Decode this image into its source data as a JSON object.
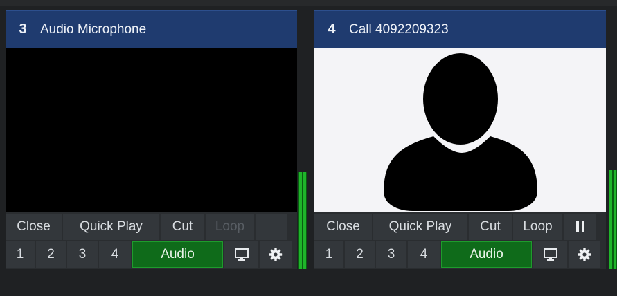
{
  "inputs": [
    {
      "number": "3",
      "title": "Audio Microphone",
      "row1": [
        "Close",
        "Quick Play",
        "Cut",
        "Loop",
        ""
      ],
      "row2": [
        "1",
        "2",
        "3",
        "4",
        "Audio"
      ],
      "loop_enabled": false
    },
    {
      "number": "4",
      "title": "Call 4092209323",
      "row1": [
        "Close",
        "Quick Play",
        "Cut",
        "Loop"
      ],
      "row2": [
        "1",
        "2",
        "3",
        "4",
        "Audio"
      ],
      "loop_enabled": true
    }
  ],
  "icons": {
    "monitor": "monitor-icon",
    "settings": "gear-icon",
    "pause": "pause-icon",
    "avatar": "person-silhouette-icon"
  },
  "colors": {
    "title_bar": "#1f3b6f",
    "audio_button": "#0f6b1a",
    "meter": "#1fb52a"
  }
}
